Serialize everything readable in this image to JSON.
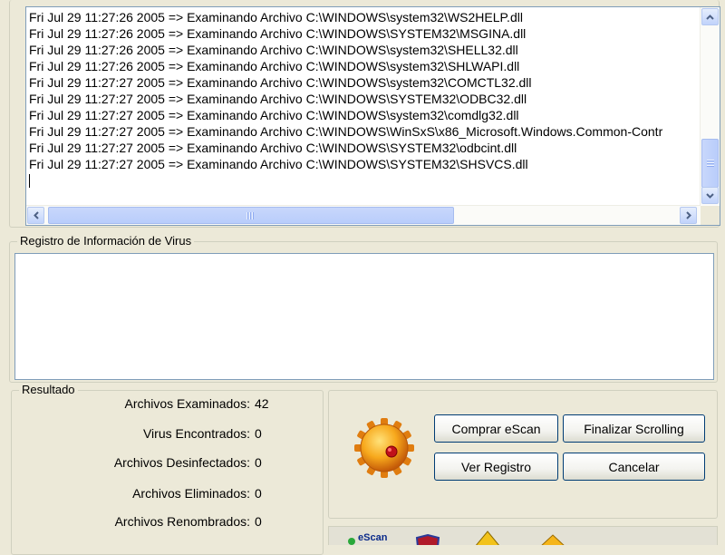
{
  "log": {
    "title": "Archivos Examinados",
    "lines": [
      "Fri Jul 29 11:27:26 2005 => Examinando Archivo C:\\WINDOWS\\system32\\WS2HELP.dll",
      "Fri Jul 29 11:27:26 2005 => Examinando Archivo C:\\WINDOWS\\SYSTEM32\\MSGINA.dll",
      "Fri Jul 29 11:27:26 2005 => Examinando Archivo C:\\WINDOWS\\system32\\SHELL32.dll",
      "Fri Jul 29 11:27:26 2005 => Examinando Archivo C:\\WINDOWS\\system32\\SHLWAPI.dll",
      "Fri Jul 29 11:27:27 2005 => Examinando Archivo C:\\WINDOWS\\system32\\COMCTL32.dll",
      "Fri Jul 29 11:27:27 2005 => Examinando Archivo C:\\WINDOWS\\SYSTEM32\\ODBC32.dll",
      "Fri Jul 29 11:27:27 2005 => Examinando Archivo C:\\WINDOWS\\system32\\comdlg32.dll",
      "Fri Jul 29 11:27:27 2005 => Examinando Archivo C:\\WINDOWS\\WinSxS\\x86_Microsoft.Windows.Common-Contr",
      "Fri Jul 29 11:27:27 2005 => Examinando Archivo C:\\WINDOWS\\SYSTEM32\\odbcint.dll",
      "Fri Jul 29 11:27:27 2005 => Examinando Archivo C:\\WINDOWS\\SYSTEM32\\SHSVCS.dll"
    ]
  },
  "virus_info": {
    "title": "Registro de Información de Virus"
  },
  "result": {
    "title": "Resultado",
    "stats": [
      {
        "label": "Archivos Examinados:",
        "value": "42"
      },
      {
        "label": "Virus Encontrados:",
        "value": "0"
      },
      {
        "label": "Archivos Desinfectados:",
        "value": "0"
      },
      {
        "label": "Archivos Eliminados:",
        "value": "0"
      },
      {
        "label": "Archivos Renombrados:",
        "value": "0"
      }
    ]
  },
  "actions": {
    "buy": "Comprar eScan",
    "stop_scroll": "Finalizar Scrolling",
    "view_log": "Ver Registro",
    "cancel": "Cancelar"
  },
  "toolbar": {
    "logo_text": "eScan"
  },
  "colors": {
    "window_bg": "#ece9d8",
    "button_border": "#003c74",
    "field_border": "#7f9db9",
    "scroll_thumb": "#c1d3fb"
  },
  "icons": {
    "scan_status": "gear-icon",
    "scroll_up": "arrow-up-icon",
    "scroll_down": "arrow-down-icon",
    "scroll_left": "arrow-left-icon",
    "scroll_right": "arrow-right-icon"
  }
}
